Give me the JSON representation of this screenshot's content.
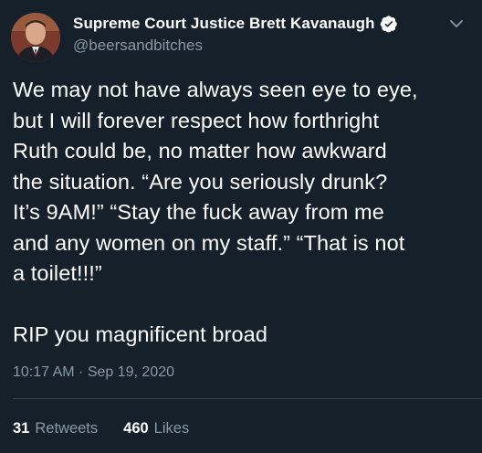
{
  "user": {
    "display_name": "Supreme Court Justice Brett Kavanaugh",
    "handle": "@beersandbitches",
    "verified": true,
    "avatar_icon": "profile-photo"
  },
  "tweet": {
    "text": "We may not have always seen eye to eye,\nbut I will forever respect how forthright\nRuth could be, no matter how awkward\nthe situation. “Are you seriously drunk?\nIt’s 9AM!” “Stay the fuck away from me\nand any women on my staff.” “That is not\na toilet!!!”\n\nRIP you magnificent broad",
    "timestamp": "10:17 AM · Sep 19, 2020"
  },
  "stats": {
    "retweets_count": "31",
    "retweets_label": "Retweets",
    "likes_count": "460",
    "likes_label": "Likes"
  },
  "colors": {
    "background": "#15202b",
    "text": "#ffffff",
    "secondary": "#8899a6",
    "divider": "#38444d"
  }
}
